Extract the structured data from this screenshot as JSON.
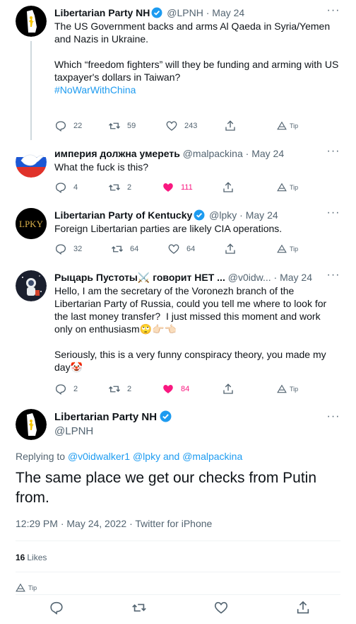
{
  "tweets": [
    {
      "name": "Libertarian Party NH",
      "verified": true,
      "handle": "@LPNH",
      "separator": "·",
      "date": "May 24",
      "text": "The US Government backs and arms Al Qaeda in Syria/Yemen and Nazis in Ukraine.\n\nWhich “freedom fighters” will they be funding and arming with US taxpayer's dollars in Taiwan?",
      "hashtag": "#NoWarWithChina",
      "replies": "22",
      "retweets": "59",
      "likes": "243",
      "tip": "Tip"
    },
    {
      "name": "империя должна умереть",
      "verified": false,
      "handle": "@malpackina",
      "separator": "·",
      "date": "May 24",
      "text": "What the fuck is this?",
      "replies": "4",
      "retweets": "2",
      "likes": "111",
      "tip": "Tip"
    },
    {
      "name": "Libertarian Party of Kentucky",
      "verified": true,
      "handle": "@lpky",
      "separator": "·",
      "date": "May 24",
      "avatar_text": "LPKY",
      "text": "Foreign Libertarian parties are likely CIA operations.",
      "replies": "32",
      "retweets": "64",
      "likes": "64",
      "tip": "Tip"
    },
    {
      "name": "Рыцарь Пустоты⚔️ говорит НЕТ ...",
      "verified": false,
      "handle": "@v0idw...",
      "separator": "·",
      "date": "May 24",
      "text": "Hello, I am the secretary of the Voronezh branch of the Libertarian Party of Russia, could you tell me where to look for the last money transfer?  I just missed this moment and work only on enthusiasm🙄👉🏻👈🏻\n\nSeriously, this is a very funny conspiracy theory, you made my day🤡",
      "replies": "2",
      "retweets": "2",
      "likes": "84",
      "tip": "Tip"
    }
  ],
  "main": {
    "name": "Libertarian Party NH",
    "handle": "@LPNH",
    "replying_prefix": "Replying to ",
    "replying_users": "@v0idwalker1 @lpky",
    "replying_and": " and ",
    "replying_last": "@malpackina",
    "text": "The same place we get our checks from Putin from.",
    "timestamp": "12:29 PM · May 24, 2022 · Twitter for iPhone",
    "likes_count": "16",
    "likes_label": "Likes",
    "tip": "Tip"
  },
  "colors": {
    "accent": "#1d9bf0",
    "like": "#f91880",
    "muted": "#536471",
    "text": "#0f1419"
  }
}
